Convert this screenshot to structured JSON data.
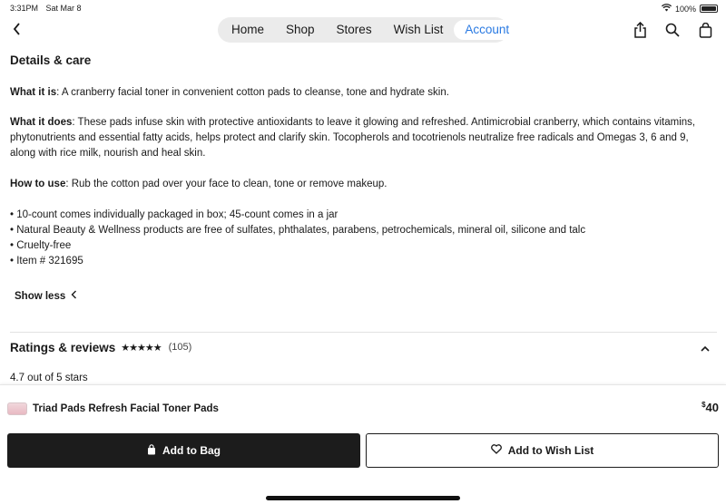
{
  "status": {
    "time": "3:31PM",
    "date": "Sat Mar 8",
    "battery": "100%"
  },
  "nav": {
    "tabs": [
      {
        "label": "Home",
        "active": false
      },
      {
        "label": "Shop",
        "active": false
      },
      {
        "label": "Stores",
        "active": false
      },
      {
        "label": "Wish List",
        "active": false
      },
      {
        "label": "Account",
        "active": true
      }
    ],
    "icons": [
      "share-icon",
      "search-icon",
      "bag-icon"
    ],
    "accent": "#2a7ae2"
  },
  "details": {
    "title": "Details & care",
    "what_it_is_label": "What it is",
    "what_it_is": ": A cranberry facial toner in convenient cotton pads to cleanse, tone and hydrate skin.",
    "what_it_does_label": "What it does",
    "what_it_does": ": These pads infuse skin with protective antioxidants to leave it glowing and refreshed. Antimicrobial cranberry, which contains vitamins, phytonutrients and essential fatty acids, helps protect and clarify skin. Tocopherols and tocotrienols neutralize free radicals and Omegas 3, 6 and 9, along with rice milk, nourish and heal skin.",
    "how_to_use_label": "How to use",
    "how_to_use": ": Rub the cotton pad over your face to clean, tone or remove makeup.",
    "bullets": [
      "• 10-count comes individually packaged in box; 45-count comes in a jar",
      "• Natural Beauty & Wellness products are free of sulfates, phthalates, parabens, petrochemicals, mineral oil, silicone and talc",
      "• Cruelty-free",
      "• Item # 321695"
    ],
    "show_less": "Show less"
  },
  "ratings": {
    "title": "Ratings & reviews",
    "stars": "★★★★★",
    "count": "(105)",
    "summary": "4.7 out of 5 stars"
  },
  "product": {
    "name": "Triad Pads Refresh Facial Toner Pads",
    "currency": "$",
    "price": "40"
  },
  "actions": {
    "add_to_bag": "Add to Bag",
    "add_to_wish_list": "Add to Wish List"
  }
}
